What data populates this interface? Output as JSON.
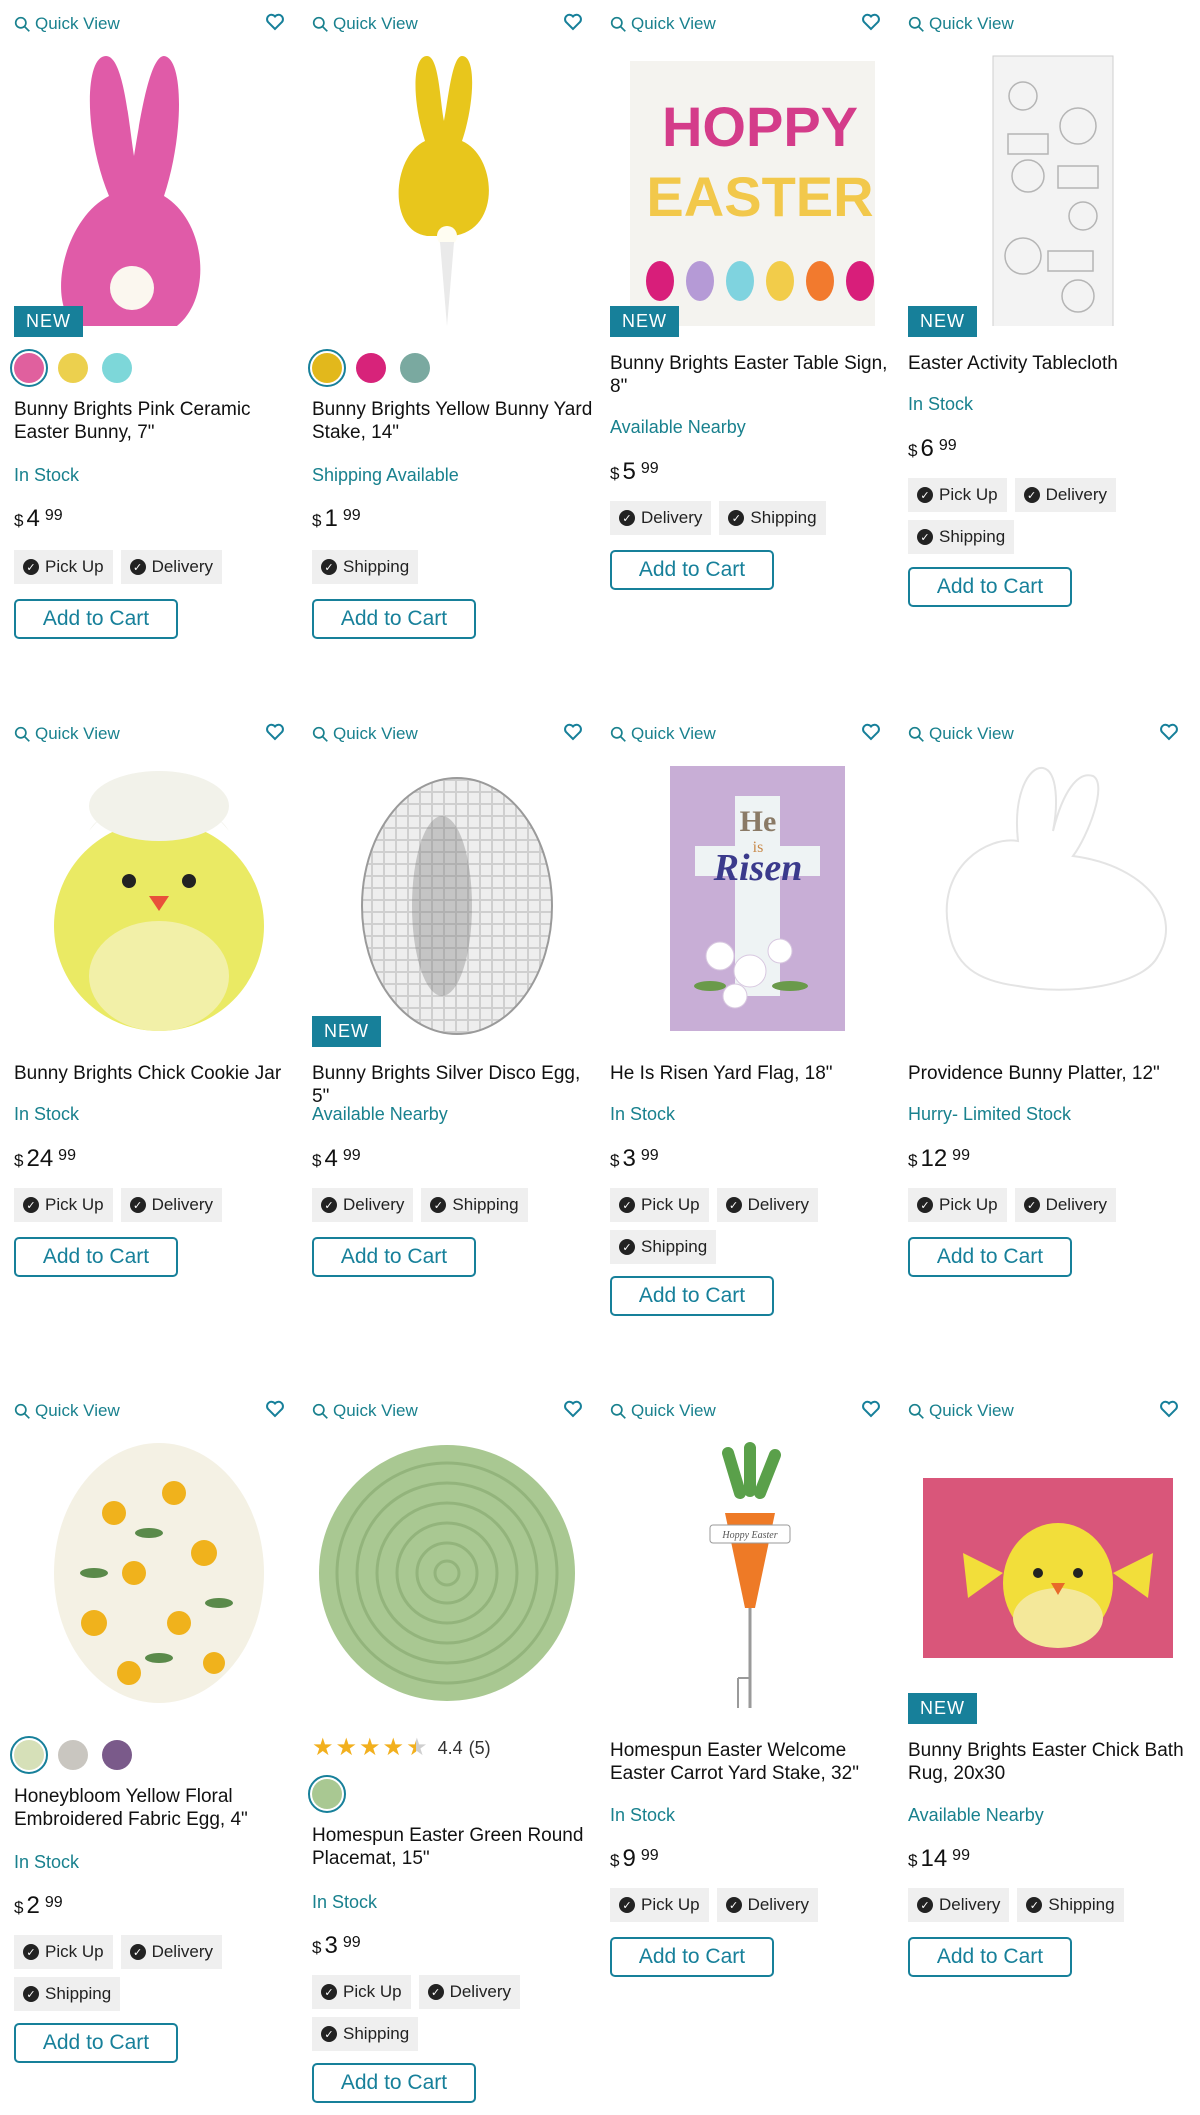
{
  "common": {
    "quick_view": "Quick View",
    "add_to_cart": "Add to Cart",
    "new_badge": "NEW",
    "currency": "$"
  },
  "products": [
    {
      "title": "Bunny Brights Pink Ceramic Easter Bunny, 7\"",
      "stock": "In Stock",
      "dollars": "4",
      "cents": "99",
      "fulfillment": [
        "Pick Up",
        "Delivery"
      ],
      "new": true,
      "swatches": [
        "#e0609e",
        "#ecd04e",
        "#7dd7d9"
      ]
    },
    {
      "title": "Bunny Brights Yellow Bunny Yard Stake, 14\"",
      "stock": "Shipping Available",
      "dollars": "1",
      "cents": "99",
      "fulfillment": [
        "Shipping"
      ],
      "new": false,
      "swatches": [
        "#e2b81c",
        "#d7237a",
        "#7aa9a0"
      ]
    },
    {
      "title": "Bunny Brights Easter Table Sign, 8\"",
      "stock": "Available Nearby",
      "dollars": "5",
      "cents": "99",
      "fulfillment": [
        "Delivery",
        "Shipping"
      ],
      "new": true,
      "swatches": []
    },
    {
      "title": "Easter Activity Tablecloth",
      "stock": "In Stock",
      "dollars": "6",
      "cents": "99",
      "fulfillment": [
        "Pick Up",
        "Delivery",
        "Shipping"
      ],
      "new": true,
      "swatches": []
    },
    {
      "title": "Bunny Brights Chick Cookie Jar",
      "stock": "In Stock",
      "dollars": "24",
      "cents": "99",
      "fulfillment": [
        "Pick Up",
        "Delivery"
      ],
      "new": false,
      "swatches": []
    },
    {
      "title": "Bunny Brights Silver Disco Egg, 5\"",
      "stock": "Available Nearby",
      "dollars": "4",
      "cents": "99",
      "fulfillment": [
        "Delivery",
        "Shipping"
      ],
      "new": true,
      "swatches": []
    },
    {
      "title": "He Is Risen Yard Flag, 18\"",
      "stock": "In Stock",
      "dollars": "3",
      "cents": "99",
      "fulfillment": [
        "Pick Up",
        "Delivery",
        "Shipping"
      ],
      "new": false,
      "swatches": []
    },
    {
      "title": "Providence Bunny Platter, 12\"",
      "stock": "Hurry- Limited Stock",
      "dollars": "12",
      "cents": "99",
      "fulfillment": [
        "Pick Up",
        "Delivery"
      ],
      "new": false,
      "swatches": []
    },
    {
      "title": "Honeybloom Yellow Floral Embroidered Fabric Egg, 4\"",
      "stock": "In Stock",
      "dollars": "2",
      "cents": "99",
      "fulfillment": [
        "Pick Up",
        "Delivery",
        "Shipping"
      ],
      "new": false,
      "swatches": [
        "#d6e0b8",
        "#c9c6c0",
        "#7a5a8a"
      ]
    },
    {
      "title": "Homespun Easter Green Round Placemat, 15\"",
      "stock": "In Stock",
      "dollars": "3",
      "cents": "99",
      "fulfillment": [
        "Pick Up",
        "Delivery",
        "Shipping"
      ],
      "new": false,
      "swatches": [
        "#a9c892"
      ],
      "rating": "4.4",
      "reviews": "(5)"
    },
    {
      "title": "Homespun Easter Welcome Easter Carrot Yard Stake, 32\"",
      "stock": "In Stock",
      "dollars": "9",
      "cents": "99",
      "fulfillment": [
        "Pick Up",
        "Delivery"
      ],
      "new": false,
      "swatches": []
    },
    {
      "title": "Bunny Brights Easter Chick Bath Rug, 20x30",
      "stock": "Available Nearby",
      "dollars": "14",
      "cents": "99",
      "fulfillment": [
        "Delivery",
        "Shipping"
      ],
      "new": true,
      "swatches": []
    }
  ],
  "images": {
    "sign_hoppy": "HOPPY",
    "sign_easter": "EASTER",
    "flag_he": "He",
    "flag_is": "is",
    "flag_risen": "Risen",
    "carrot_tag": "Hoppy Easter"
  }
}
